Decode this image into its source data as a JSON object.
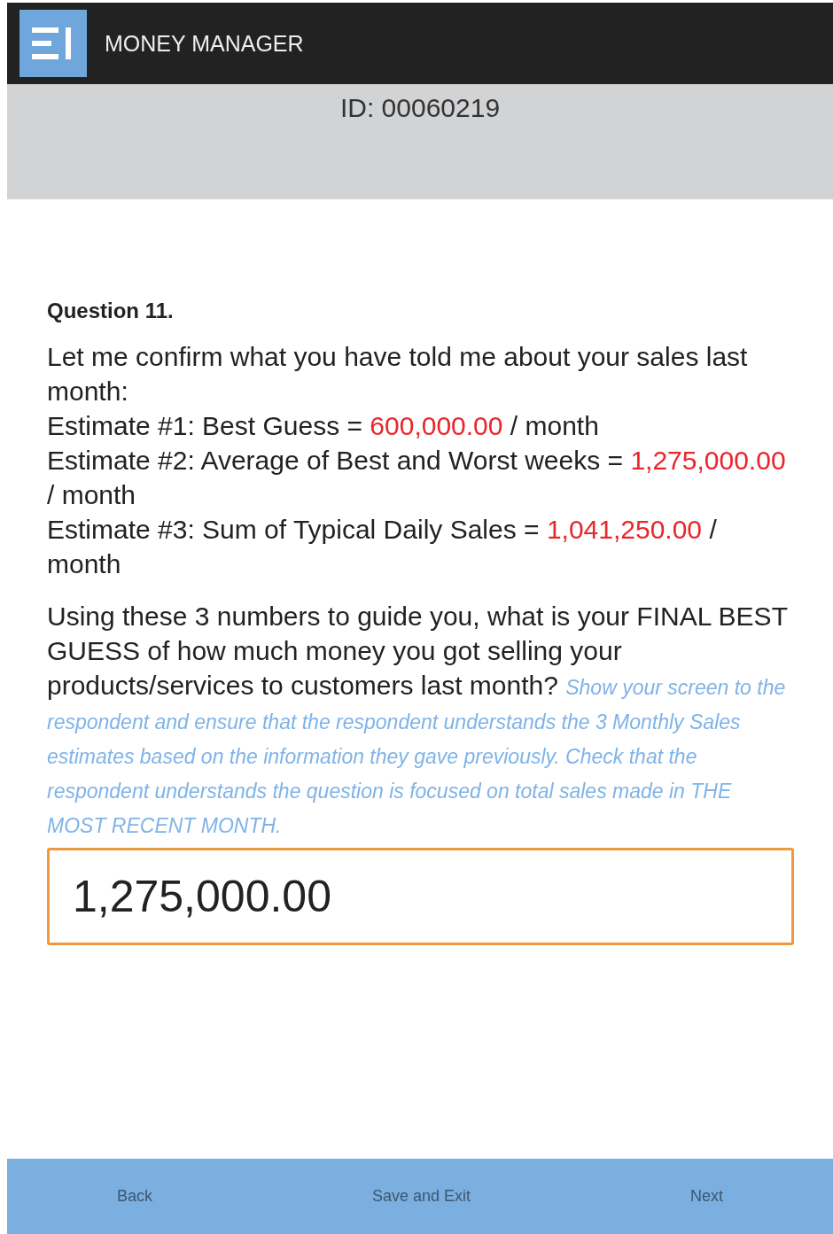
{
  "app_bar": {
    "title": "MONEY MANAGER"
  },
  "id_banner": {
    "text": "ID: 00060219"
  },
  "question": {
    "heading": "Question 11.",
    "summary_lines": [
      [
        {
          "kind": "text",
          "text": "Let me confirm what you have told me about your sales last month:"
        }
      ],
      [
        {
          "kind": "text",
          "text": "Estimate #1: Best Guess = "
        },
        {
          "kind": "value",
          "text": "600,000.00"
        },
        {
          "kind": "text",
          "text": " / month"
        }
      ],
      [
        {
          "kind": "text",
          "text": "Estimate #2: Average of Best and Worst weeks = "
        },
        {
          "kind": "value",
          "text": "1,275,000.00"
        },
        {
          "kind": "text",
          "text": " / month"
        }
      ],
      [
        {
          "kind": "text",
          "text": "Estimate #3: Sum of Typical Daily Sales = "
        },
        {
          "kind": "value",
          "text": "1,041,250.00"
        },
        {
          "kind": "text",
          "text": " / month"
        }
      ]
    ],
    "prompt": [
      {
        "kind": "text",
        "text": "Using these 3 numbers to guide you, what is your FINAL BEST GUESS of how much money you got selling your products/services to customers last month? "
      },
      {
        "kind": "hint",
        "text": "Show your screen to the respondent and ensure that the respondent understands the 3 Monthly Sales estimates based on the information they gave previously. Check that the respondent understands the question is focused on total sales made in THE MOST RECENT MONTH."
      }
    ],
    "answer": {
      "value": "1,275,000.00"
    }
  },
  "footer": {
    "buttons": [
      "Back",
      "Save and Exit",
      "Next"
    ]
  }
}
